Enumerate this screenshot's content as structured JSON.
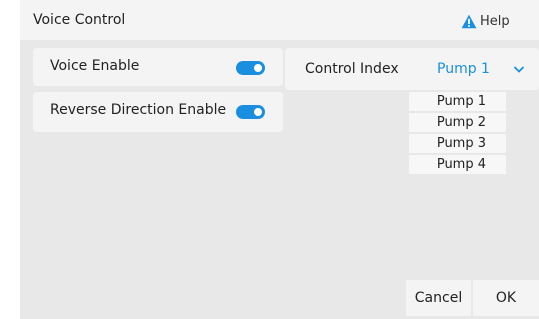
{
  "window": {
    "title": "Voice Control"
  },
  "help": {
    "label": "Help",
    "icon": "warning-icon",
    "icon_color": "#1a8fe0"
  },
  "settings": [
    {
      "label": "Voice  Enable",
      "enabled": true
    },
    {
      "label": "Reverse Direction Enable",
      "enabled": true
    }
  ],
  "control": {
    "label": "Control Index",
    "selected": "Pump 1",
    "options": [
      "Pump 1",
      "Pump 2",
      "Pump 3",
      "Pump 4"
    ]
  },
  "footer": {
    "cancel_label": "Cancel",
    "ok_label": "OK"
  },
  "colors": {
    "accent": "#1a8fe0",
    "panel": "#f4f4f4",
    "background": "#e8e8e8"
  }
}
